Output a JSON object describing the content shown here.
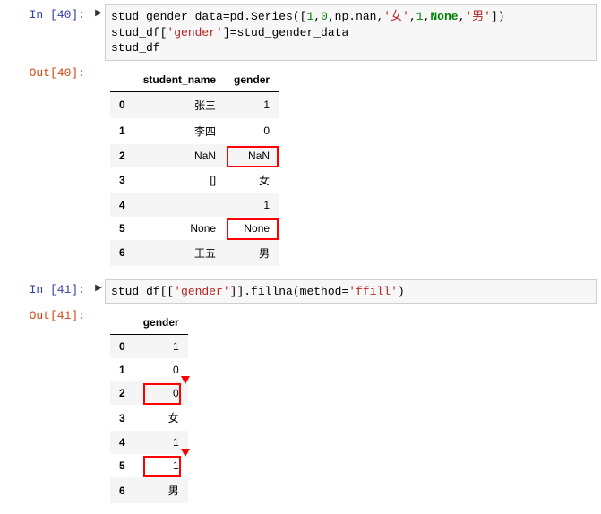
{
  "cell40": {
    "in_prompt": "In [40]:",
    "out_prompt": "Out[40]:",
    "code_line1_pre": "stud_gender_data=pd.Series([",
    "code_line1_n1": "1",
    "code_line1_c1": ",",
    "code_line1_n2": "0",
    "code_line1_c2": ",np.nan,",
    "code_line1_s1": "'女'",
    "code_line1_c3": ",",
    "code_line1_n3": "1",
    "code_line1_c4": ",",
    "code_line1_kw": "None",
    "code_line1_c5": ",",
    "code_line1_s2": "'男'",
    "code_line1_end": "])",
    "code_line2_a": "stud_df[",
    "code_line2_s": "'gender'",
    "code_line2_b": "]=stud_gender_data",
    "code_line3": "stud_df",
    "table": {
      "columns": [
        "student_name",
        "gender"
      ],
      "index": [
        "0",
        "1",
        "2",
        "3",
        "4",
        "5",
        "6"
      ],
      "rows": [
        [
          "张三",
          "1"
        ],
        [
          "李四",
          "0"
        ],
        [
          "NaN",
          "NaN"
        ],
        [
          "[]",
          "女"
        ],
        [
          "",
          "1"
        ],
        [
          "None",
          "None"
        ],
        [
          "王五",
          "男"
        ]
      ],
      "highlight_gender_rows": [
        2,
        5
      ]
    }
  },
  "cell41": {
    "in_prompt": "In [41]:",
    "out_prompt": "Out[41]:",
    "code_a": "stud_df[[",
    "code_s1": "'gender'",
    "code_b": "]].fillna(method=",
    "code_s2": "'ffill'",
    "code_c": ")",
    "table": {
      "columns": [
        "gender"
      ],
      "index": [
        "0",
        "1",
        "2",
        "3",
        "4",
        "5",
        "6"
      ],
      "rows": [
        [
          "1"
        ],
        [
          "0"
        ],
        [
          "0"
        ],
        [
          "女"
        ],
        [
          "1"
        ],
        [
          "1"
        ],
        [
          "男"
        ]
      ],
      "highlight_rows": [
        2,
        5
      ],
      "arrow_rows": [
        1,
        4
      ]
    }
  }
}
